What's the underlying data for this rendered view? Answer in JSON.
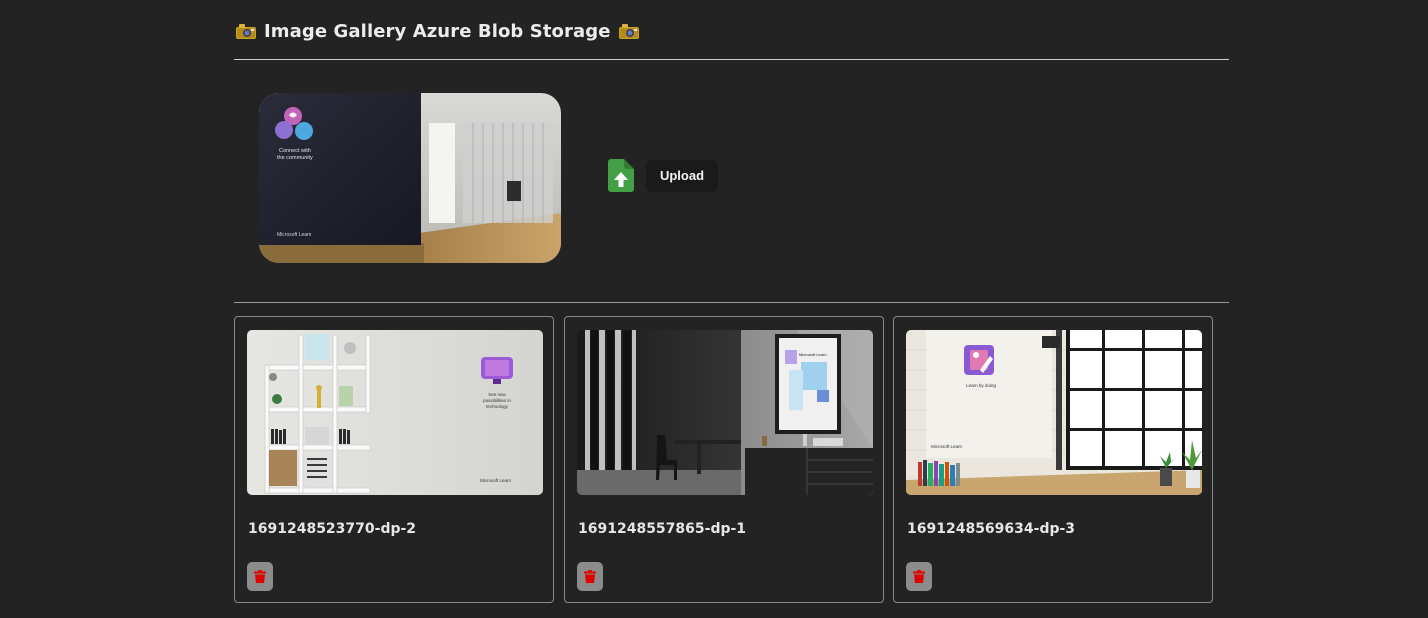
{
  "page": {
    "title": "Image Gallery Azure Blob Storage",
    "title_icon": "camera-with-flash-emoji"
  },
  "preview": {
    "label": "Connect with the community",
    "brand": "Microsoft Learn"
  },
  "upload": {
    "button_label": "Upload",
    "icon": "file-upload-icon"
  },
  "gallery": {
    "items": [
      {
        "name": "1691248523770-dp-2",
        "caption": "See new possibilities in technology",
        "brand": "Microsoft Learn"
      },
      {
        "name": "1691248557865-dp-1",
        "caption": "Microsoft Learn",
        "brand": ""
      },
      {
        "name": "1691248569634-dp-3",
        "caption": "Learn by doing",
        "brand": "Microsoft Learn"
      }
    ],
    "delete_icon": "trash-icon"
  },
  "colors": {
    "background": "#232323",
    "upload_icon": "#43a047",
    "delete_icon": "#e00000",
    "delete_button": "#8c8c8c"
  }
}
